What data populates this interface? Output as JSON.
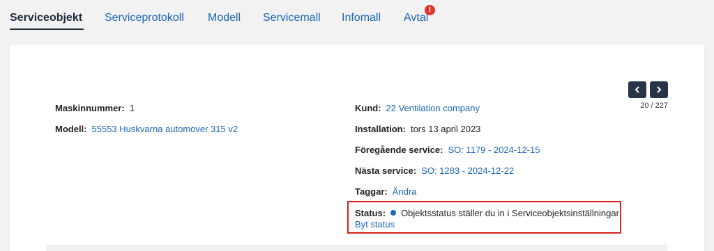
{
  "tabs": [
    {
      "label": "Serviceobjekt",
      "active": true
    },
    {
      "label": "Serviceprotokoll"
    },
    {
      "label": "Modell"
    },
    {
      "label": "Servicemall"
    },
    {
      "label": "Infomall"
    },
    {
      "label": "Avtal",
      "badge": "!"
    }
  ],
  "pager": {
    "text": "20 / 227"
  },
  "left_fields": {
    "machine_number": {
      "label": "Maskinnummer:",
      "value": "1"
    },
    "model": {
      "label": "Modell:",
      "value": "55553 Huskvarna automover 315 v2"
    }
  },
  "right_fields": {
    "customer": {
      "label": "Kund:",
      "value": "22 Ventilation company"
    },
    "installation": {
      "label": "Installation:",
      "value": "tors 13 april 2023"
    },
    "previous_service": {
      "label": "Föregående service:",
      "value": "SO: 1179 - 2024-12-15"
    },
    "next_service": {
      "label": "Nästa service:",
      "value": "SO: 1283 - 2024-12-22"
    },
    "tags": {
      "label": "Taggar:",
      "value": "Ändra"
    },
    "status": {
      "label": "Status:",
      "value": "Objektsstatus ställer du in i Serviceobjektsinställningar",
      "action": "Byt status",
      "dot_color": "#1a66b3"
    }
  },
  "colors": {
    "accent": "#1a66b3",
    "highlight_border": "#d9201b",
    "nav_button": "#273447",
    "badge": "#e0352b"
  }
}
